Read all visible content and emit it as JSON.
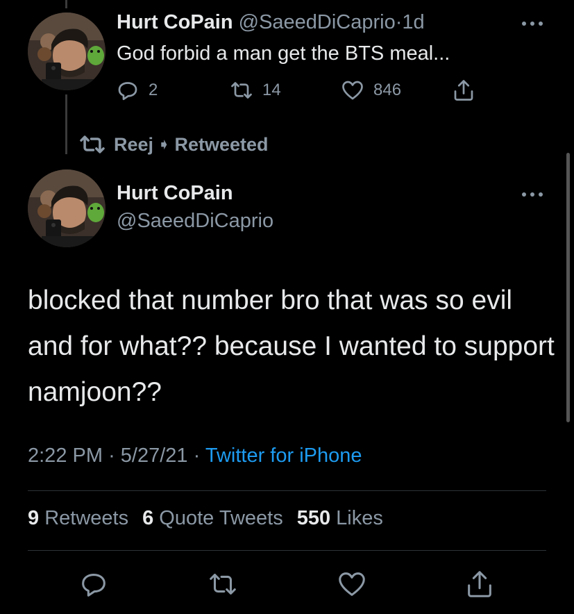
{
  "parent_tweet": {
    "author_name": "Hurt CoPain",
    "handle": "@SaeedDiCaprio",
    "separator": "·",
    "age": "1d",
    "text": "God forbid a man get the BTS meal...",
    "reply_count": "2",
    "retweet_count": "14",
    "like_count": "846"
  },
  "retweet_notice": {
    "user": "Reej",
    "label": "Retweeted"
  },
  "main_tweet": {
    "author_name": "Hurt CoPain",
    "handle": "@SaeedDiCaprio",
    "text": "blocked that number bro that was so evil and for what?? because I wanted to support namjoon??",
    "time": "2:22 PM",
    "sep1": "·",
    "date": "5/27/21",
    "sep2": "·",
    "source": "Twitter for iPhone",
    "stats": {
      "retweets_count": "9",
      "retweets_label": "Retweets",
      "quotes_count": "6",
      "quotes_label": "Quote Tweets",
      "likes_count": "550",
      "likes_label": "Likes"
    }
  },
  "icons": {
    "reply": "reply-icon",
    "retweet": "retweet-icon",
    "like": "heart-icon",
    "share": "share-icon",
    "more": "more-icon"
  },
  "colors": {
    "background": "#000000",
    "text": "#e7e9ea",
    "muted": "#8b98a5",
    "link": "#1d9bf0",
    "divider": "#2f3336"
  }
}
